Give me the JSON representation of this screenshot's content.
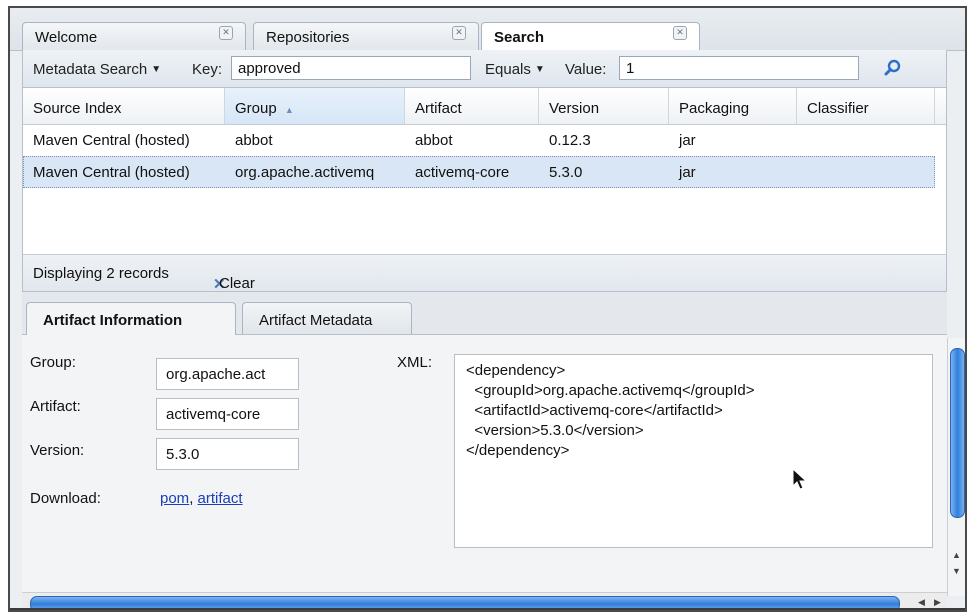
{
  "tabs": [
    {
      "label": "Welcome",
      "close": "✕"
    },
    {
      "label": "Repositories",
      "close": "✕"
    },
    {
      "label": "Search",
      "close": "✕"
    }
  ],
  "search": {
    "mode_label": "Metadata Search",
    "key_label": "Key:",
    "key_value": "approved",
    "operator_label": "Equals",
    "value_label": "Value:",
    "value_value": "1",
    "search_icon": "search-icon"
  },
  "grid": {
    "columns": [
      "Source Index",
      "Group",
      "Artifact",
      "Version",
      "Packaging",
      "Classifier"
    ],
    "sort_indicator": "▲",
    "rows": [
      {
        "source": "Maven Central (hosted)",
        "group": "abbot",
        "artifact": "abbot",
        "version": "0.12.3",
        "packaging": "jar",
        "classifier": ""
      },
      {
        "source": "Maven Central (hosted)",
        "group": "org.apache.activemq",
        "artifact": "activemq-core",
        "version": "5.3.0",
        "packaging": "jar",
        "classifier": ""
      }
    ]
  },
  "status": {
    "records": "Displaying 2 records",
    "clear_icon": "✕",
    "clear_label": "Clear Results"
  },
  "detail_tabs": [
    "Artifact Information",
    "Artifact Metadata"
  ],
  "detail": {
    "group_label": "Group:",
    "group_value": "org.apache.act",
    "artifact_label": "Artifact:",
    "artifact_value": "activemq-core",
    "version_label": "Version:",
    "version_value": "5.3.0",
    "download_label": "Download:",
    "download_pom": "pom",
    "download_sep": ",",
    "download_artifact": "artifact",
    "xml_label": "XML:",
    "xml_lines": [
      "<dependency>",
      "  <groupId>org.apache.activemq</groupId>",
      "  <artifactId>activemq-core</artifactId>",
      "  <version>5.3.0</version>",
      "</dependency>"
    ]
  },
  "colors": {
    "accent": "#2f7fdd",
    "selection": "#d9e6f5",
    "link": "#1a3fb8"
  }
}
